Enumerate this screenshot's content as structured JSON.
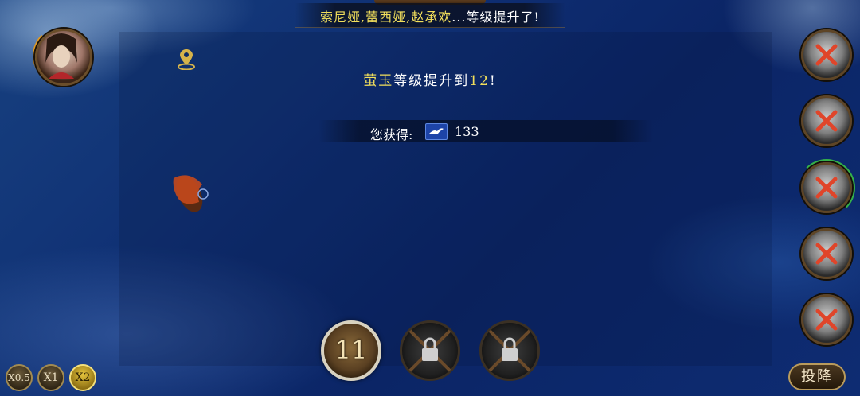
{
  "top_banner": {
    "names": "索尼娅,蕾西娅,赵承欢",
    "ellipsis": "...",
    "suffix": "等级提升了!"
  },
  "level_up": {
    "name": "萤玉",
    "text": "等级提升到",
    "level": "12",
    "end": "!"
  },
  "reward": {
    "label": "您获得:",
    "value": "133",
    "icon": "seabird-icon"
  },
  "skills": {
    "main_count": "11",
    "locked": [
      "lock-icon",
      "lock-icon"
    ]
  },
  "speed": {
    "options": [
      "X0.5",
      "X1",
      "X2"
    ],
    "selected": "X2"
  },
  "surrender_label": "投降",
  "enemies": {
    "count": 5,
    "status": "defeated"
  },
  "colors": {
    "highlight": "#f2df5c",
    "sea": "#0d2a66"
  }
}
